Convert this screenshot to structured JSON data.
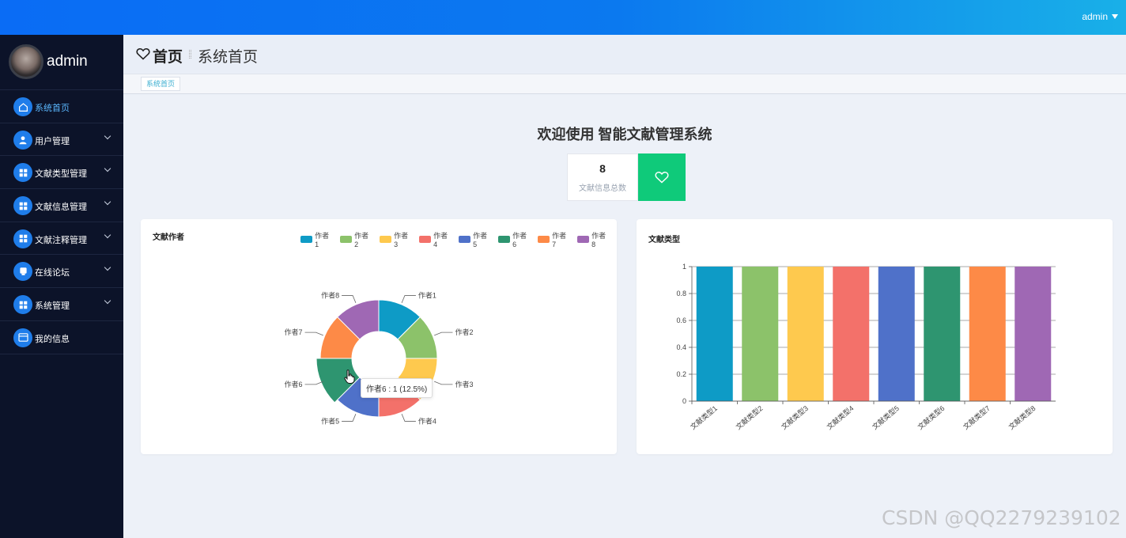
{
  "header": {
    "user": "admin"
  },
  "sidebar": {
    "profile_name": "admin",
    "items": [
      {
        "label": "系统首页",
        "icon": "home-icon",
        "active": true,
        "expandable": false
      },
      {
        "label": "用户管理",
        "icon": "user-icon",
        "expandable": true
      },
      {
        "label": "文献类型管理",
        "icon": "grid-icon",
        "expandable": true
      },
      {
        "label": "文献信息管理",
        "icon": "grid-icon",
        "expandable": true
      },
      {
        "label": "文献注释管理",
        "icon": "grid-icon",
        "expandable": true
      },
      {
        "label": "在线论坛",
        "icon": "forum-icon",
        "expandable": true
      },
      {
        "label": "系统管理",
        "icon": "grid-icon",
        "expandable": true
      },
      {
        "label": "我的信息",
        "icon": "card-icon",
        "expandable": false
      }
    ]
  },
  "page": {
    "title": "首页",
    "subtitle": "系统首页",
    "tab": "系统首页"
  },
  "welcome": "欢迎使用 智能文献管理系统",
  "stat": {
    "value": "8",
    "label": "文献信息总数"
  },
  "colors": [
    "#0e9bc6",
    "#8cc26a",
    "#fec94e",
    "#f3716a",
    "#4f71c9",
    "#2e9570",
    "#fd8a47",
    "#9f68b4"
  ],
  "pie_card": {
    "title": "文献作者",
    "tooltip": "作者6 : 1 (12.5%)"
  },
  "bar_card": {
    "title": "文献类型"
  },
  "chart_data": [
    {
      "type": "pie",
      "variant": "donut",
      "title": "文献作者",
      "legend_position": "top-right",
      "categories": [
        "作者1",
        "作者2",
        "作者3",
        "作者4",
        "作者5",
        "作者6",
        "作者7",
        "作者8"
      ],
      "values": [
        1,
        1,
        1,
        1,
        1,
        1,
        1,
        1
      ]
    },
    {
      "type": "bar",
      "title": "文献类型",
      "categories": [
        "文献类型1",
        "文献类型2",
        "文献类型3",
        "文献类型4",
        "文献类型5",
        "文献类型6",
        "文献类型7",
        "文献类型8"
      ],
      "values": [
        1,
        1,
        1,
        1,
        1,
        1,
        1,
        1
      ],
      "ylim": [
        0,
        1
      ],
      "yticks": [
        "0",
        "0.2",
        "0.4",
        "0.6",
        "0.8",
        "1"
      ],
      "grid": true
    }
  ],
  "watermark": "CSDN @QQ2279239102"
}
